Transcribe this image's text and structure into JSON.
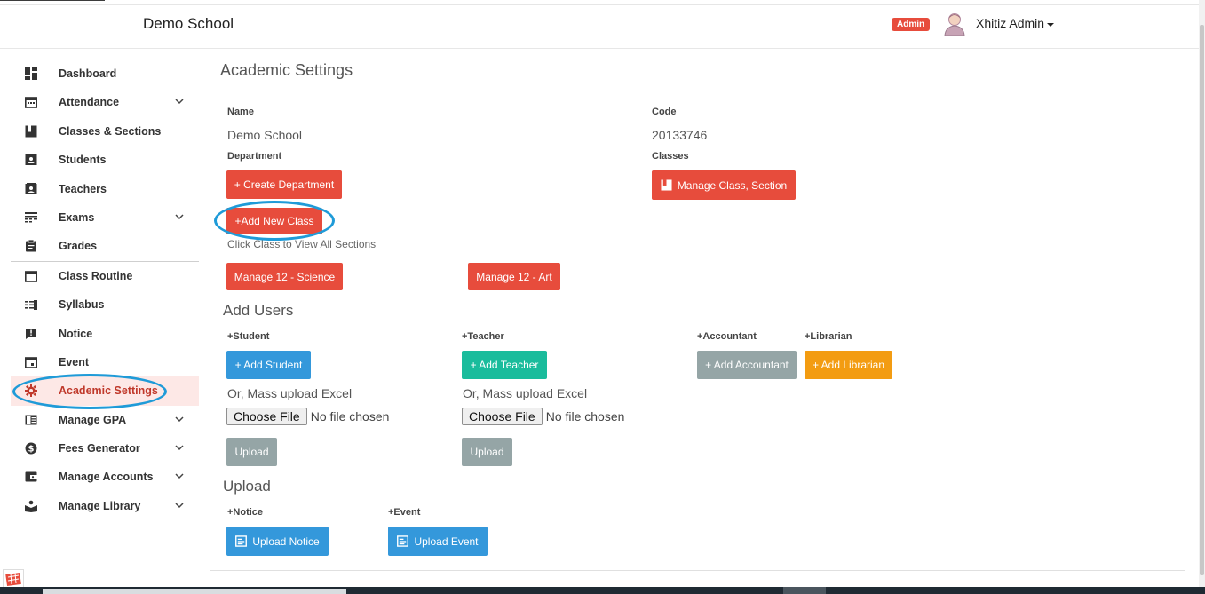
{
  "navbar": {
    "brand": "Demo School",
    "role_badge": "Admin",
    "user_name": "Xhitiz Admin"
  },
  "sidebar": {
    "items": [
      {
        "label": "Dashboard",
        "icon": "dashboard-icon",
        "has_submenu": false
      },
      {
        "label": "Attendance",
        "icon": "calendar-icon",
        "has_submenu": true
      },
      {
        "label": "Classes & Sections",
        "icon": "bookmark-icon",
        "has_submenu": false
      },
      {
        "label": "Students",
        "icon": "contact-card-icon",
        "has_submenu": false
      },
      {
        "label": "Teachers",
        "icon": "contact-card-icon",
        "has_submenu": false
      },
      {
        "label": "Exams",
        "icon": "list-icon",
        "has_submenu": true
      },
      {
        "label": "Grades",
        "icon": "clipboard-icon",
        "has_submenu": false
      },
      {
        "label": "Class Routine",
        "icon": "calendar-blank-icon",
        "has_submenu": false
      },
      {
        "label": "Syllabus",
        "icon": "list-numbered-icon",
        "has_submenu": false
      },
      {
        "label": "Notice",
        "icon": "announcement-icon",
        "has_submenu": false
      },
      {
        "label": "Event",
        "icon": "event-icon",
        "has_submenu": false
      },
      {
        "label": "Academic Settings",
        "icon": "gear-icon",
        "has_submenu": false,
        "active": true
      },
      {
        "label": "Manage GPA",
        "icon": "book-icon",
        "has_submenu": true
      },
      {
        "label": "Fees Generator",
        "icon": "dollar-icon",
        "has_submenu": true
      },
      {
        "label": "Manage Accounts",
        "icon": "wallet-icon",
        "has_submenu": true
      },
      {
        "label": "Manage Library",
        "icon": "library-icon",
        "has_submenu": true
      }
    ]
  },
  "main": {
    "title": "Academic Settings",
    "name_label": "Name",
    "name_value": "Demo School",
    "code_label": "Code",
    "code_value": "20133746",
    "department_label": "Department",
    "create_department_button": "+ Create Department",
    "classes_label": "Classes",
    "manage_class_button": "Manage Class, Section",
    "add_new_class_button": "+Add New Class",
    "class_hint": "Click Class to View All Sections",
    "class_buttons": [
      "Manage 12 - Science",
      "Manage 12 - Art"
    ],
    "add_users": {
      "title": "Add Users",
      "student_label": "+Student",
      "student_button": "+ Add Student",
      "teacher_label": "+Teacher",
      "teacher_button": "+ Add Teacher",
      "accountant_label": "+Accountant",
      "accountant_button": "+ Add Accountant",
      "librarian_label": "+Librarian",
      "librarian_button": "+ Add Librarian",
      "mass_upload_text": "Or, Mass upload Excel",
      "choose_file_button": "Choose File",
      "no_file_text": "No file chosen",
      "upload_button": "Upload"
    },
    "upload": {
      "title": "Upload",
      "notice_label": "+Notice",
      "notice_button": "Upload Notice",
      "event_label": "+Event",
      "event_button": "Upload Event"
    }
  },
  "colors": {
    "red": "#e74c3c",
    "blue": "#3498db",
    "green": "#1abc9c",
    "gray": "#95a5a6",
    "orange": "#f39c12",
    "highlight_ring": "#1f9bd8"
  }
}
